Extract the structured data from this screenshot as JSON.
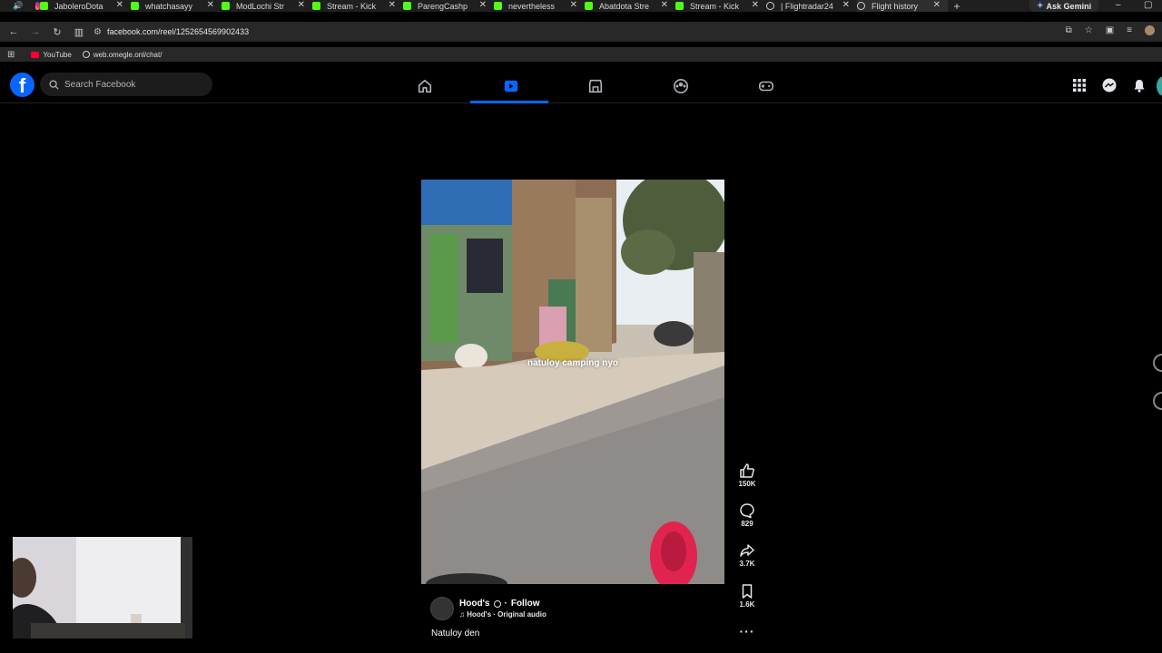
{
  "browser": {
    "tabs": [
      {
        "label": "JaboleroDota",
        "icon": "kick-icon"
      },
      {
        "label": "whatchasayy",
        "icon": "kick-icon"
      },
      {
        "label": "ModLochi Str",
        "icon": "kick-icon"
      },
      {
        "label": "Stream - Kick",
        "icon": "kick-icon"
      },
      {
        "label": "ParengCashp",
        "icon": "kick-icon"
      },
      {
        "label": "nevertheless",
        "icon": "kick-icon"
      },
      {
        "label": "Abatdota Stre",
        "icon": "kick-icon"
      },
      {
        "label": "Stream - Kick",
        "icon": "kick-icon"
      },
      {
        "label": "| Flightradar24",
        "icon": "globe-icon"
      },
      {
        "label": "Flight history",
        "icon": "globe-icon"
      }
    ],
    "ask_gemini": "Ask Gemini",
    "url": "facebook.com/reel/1252654569902433",
    "bookmarks": [
      {
        "label": "YouTube",
        "icon": "youtube-icon"
      },
      {
        "label": "web.omegle.onl/chat/",
        "icon": "globe-icon"
      }
    ]
  },
  "facebook": {
    "search_placeholder": "Search Facebook",
    "nav": [
      "home-icon",
      "video-icon",
      "marketplace-icon",
      "groups-icon",
      "gaming-icon"
    ],
    "accent": "#0866ff"
  },
  "reel": {
    "overlay_text": "natuloy camping nyo",
    "likes": "150K",
    "comments": "829",
    "shares": "3.7K",
    "saves": "1.6K",
    "author": "Hood's",
    "follow": "Follow",
    "audio": "Hood's · Original audio",
    "caption": "Natuloy den"
  }
}
